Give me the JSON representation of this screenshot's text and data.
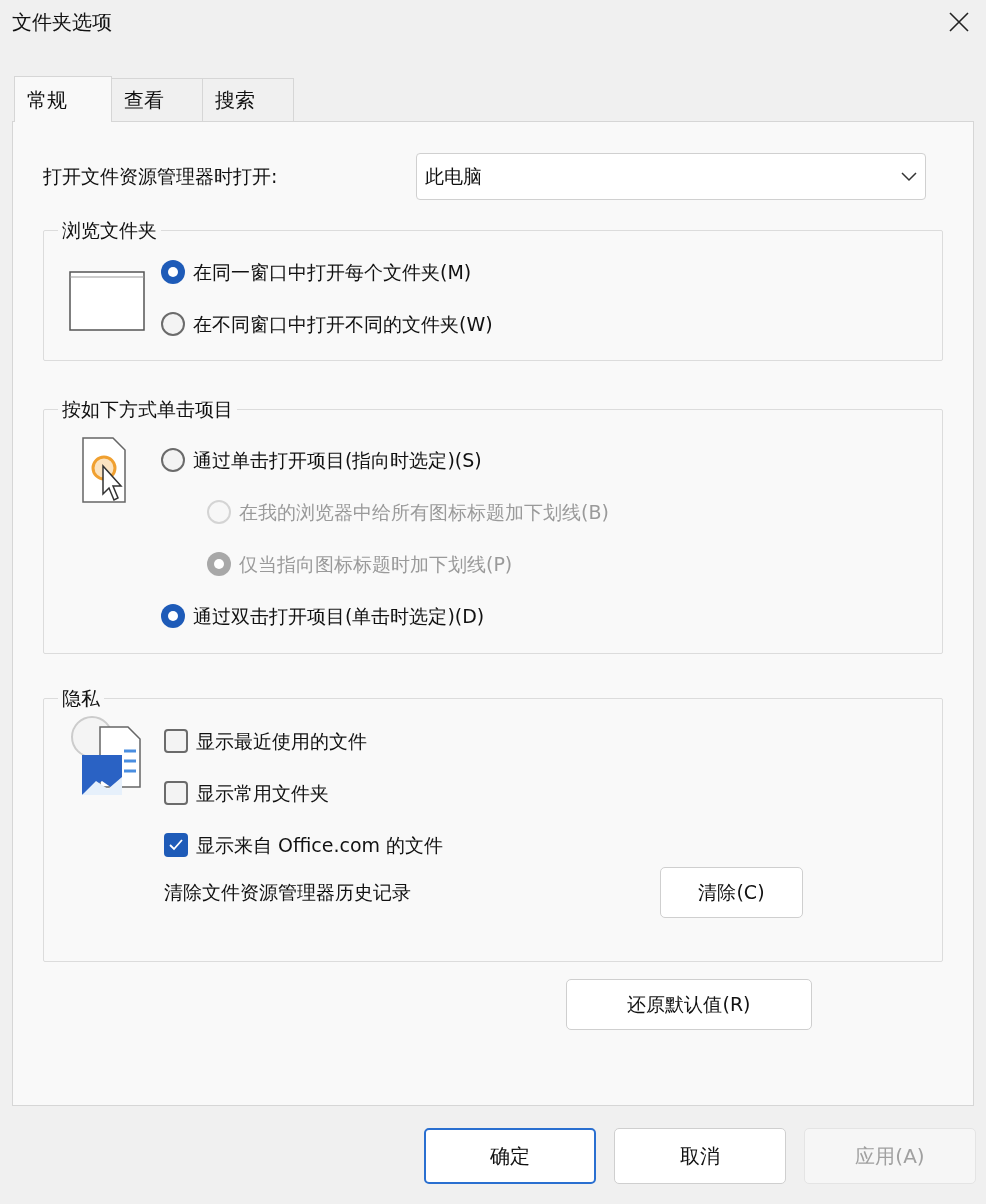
{
  "window": {
    "title": "文件夹选项"
  },
  "tabs": [
    {
      "label": "常规",
      "selected": true
    },
    {
      "label": "查看",
      "selected": false
    },
    {
      "label": "搜索",
      "selected": false
    }
  ],
  "open_explorer": {
    "label": "打开文件资源管理器时打开:",
    "value": "此电脑"
  },
  "browse_folders": {
    "legend": "浏览文件夹",
    "options": [
      {
        "label": "在同一窗口中打开每个文件夹(M)",
        "selected": true,
        "disabled": false
      },
      {
        "label": "在不同窗口中打开不同的文件夹(W)",
        "selected": false,
        "disabled": false
      }
    ]
  },
  "click_items": {
    "legend": "按如下方式单击项目",
    "options": [
      {
        "label": "通过单击打开项目(指向时选定)(S)",
        "selected": false,
        "disabled": false,
        "children": [
          {
            "label": "在我的浏览器中给所有图标标题加下划线(B)",
            "selected": false,
            "disabled": true
          },
          {
            "label": "仅当指向图标标题时加下划线(P)",
            "selected": true,
            "disabled": true
          }
        ]
      },
      {
        "label": "通过双击打开项目(单击时选定)(D)",
        "selected": true,
        "disabled": false
      }
    ]
  },
  "privacy": {
    "legend": "隐私",
    "checkboxes": [
      {
        "label": "显示最近使用的文件",
        "checked": false
      },
      {
        "label": "显示常用文件夹",
        "checked": false
      },
      {
        "label": "显示来自 Office.com 的文件",
        "checked": true
      }
    ],
    "clear_label": "清除文件资源管理器历史记录",
    "clear_button": "清除(C)"
  },
  "restore_button": "还原默认值(R)",
  "buttons": [
    {
      "label": "确定",
      "kind": "default",
      "disabled": false
    },
    {
      "label": "取消",
      "kind": "normal",
      "disabled": false
    },
    {
      "label": "应用(A)",
      "kind": "normal",
      "disabled": true
    }
  ]
}
